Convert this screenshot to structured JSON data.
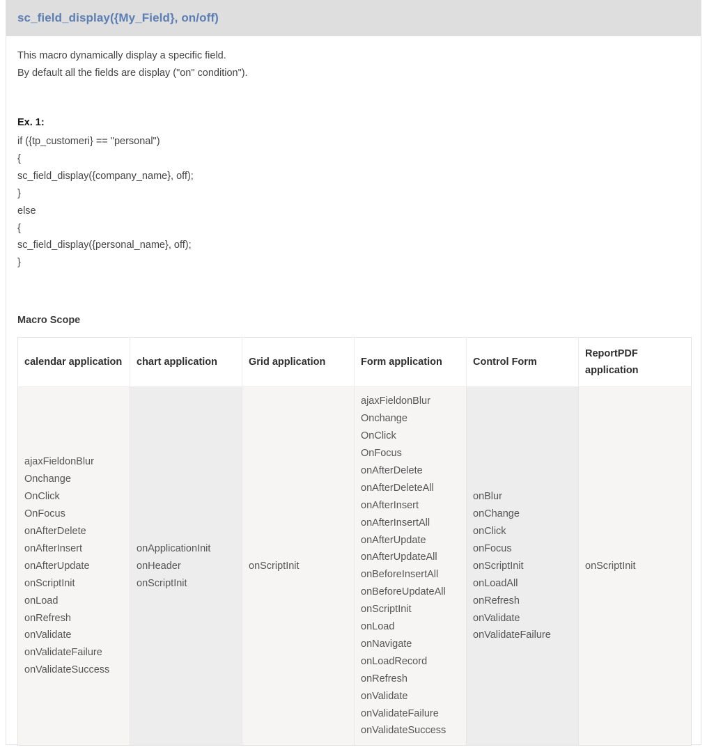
{
  "header": {
    "title": "sc_field_display({My_Field}, on/off)",
    "title_color": "#5b7fb4",
    "bar_color": "#dededf"
  },
  "description": {
    "line1": "This macro dynamically display a specific field.",
    "line2": "By default all the fields are display (\"on\" condition\")."
  },
  "example": {
    "label": "Ex. 1:",
    "lines": [
      "if ({tp_customeri} == \"personal\")",
      "{",
      "sc_field_display({company_name}, off);",
      "}",
      "else",
      "{",
      "sc_field_display({personal_name}, off);",
      "}"
    ]
  },
  "scope": {
    "label": "Macro Scope",
    "columns": [
      {
        "header": "calendar application",
        "events": [
          "ajaxFieldonBlur",
          "Onchange",
          "OnClick",
          "OnFocus",
          "onAfterDelete",
          "onAfterInsert",
          "onAfterUpdate",
          "onScriptInit",
          "onLoad",
          "onRefresh",
          "onValidate",
          "onValidateFailure",
          "onValidateSuccess"
        ]
      },
      {
        "header": "chart application",
        "events": [
          "onApplicationInit",
          "onHeader",
          "onScriptInit"
        ]
      },
      {
        "header": "Grid application",
        "events": [
          "onScriptInit"
        ]
      },
      {
        "header": "Form application",
        "events": [
          "ajaxFieldonBlur",
          "Onchange",
          "OnClick",
          "OnFocus",
          "onAfterDelete",
          "onAfterDeleteAll",
          "onAfterInsert",
          "onAfterInsertAll",
          "onAfterUpdate",
          "onAfterUpdateAll",
          "onBeforeInsertAll",
          "onBeforeUpdateAll",
          "onScriptInit",
          "onLoad",
          "onNavigate",
          "onLoadRecord",
          "onRefresh",
          "onValidate",
          "onValidateFailure",
          "onValidateSuccess"
        ]
      },
      {
        "header": "Control Form",
        "events": [
          "onBlur",
          "onChange",
          "onClick",
          "onFocus",
          "onScriptInit",
          "onLoadAll",
          "onRefresh",
          "onValidate",
          "onValidateFailure"
        ]
      },
      {
        "header": "ReportPDF application",
        "events": [
          "onScriptInit"
        ]
      }
    ]
  }
}
